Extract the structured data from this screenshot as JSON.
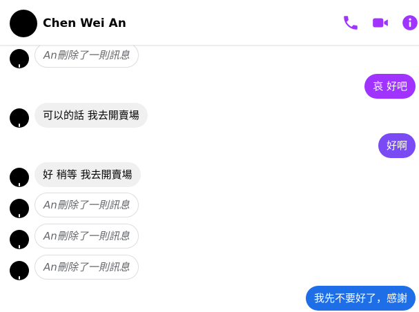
{
  "header": {
    "contact_name": "Chen Wei An",
    "icons": [
      "phone-icon",
      "video-camera-icon",
      "info-icon"
    ],
    "accent_color": "#a033ff"
  },
  "messages": {
    "m1": "An刪除了一則訊息",
    "m2": "哀 好吧",
    "m3": "可以的話 我去開賣場",
    "m4": "好啊",
    "m5": "好 稍等 我去開賣場",
    "m6": "An刪除了一則訊息",
    "m7": "An刪除了一則訊息",
    "m8": "An刪除了一則訊息",
    "m9": "我先不要好了，感謝"
  },
  "colors": {
    "outgoing_top": "#a033ff",
    "outgoing_mid": "#7a4bf4",
    "outgoing_bottom": "#1e6ee8",
    "incoming_bg": "#f0f0f0"
  }
}
